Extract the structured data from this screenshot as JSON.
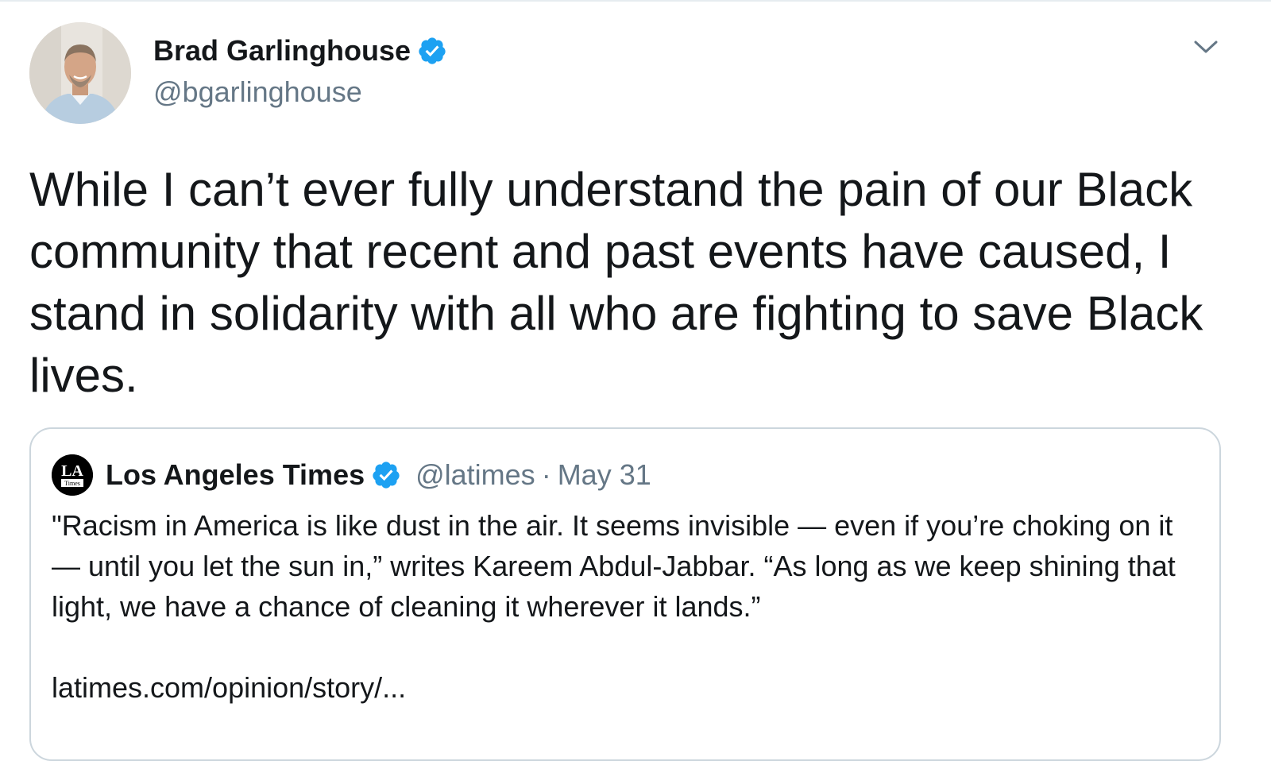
{
  "tweet": {
    "author": {
      "name": "Brad Garlinghouse",
      "handle": "@bgarlinghouse",
      "verified": true
    },
    "text": "While I can’t ever fully understand the pain of our Black community that recent and past events have caused, I stand in solidarity with all who are fighting to save Black lives.",
    "menu_icon": "chevron-down-icon"
  },
  "quoted": {
    "author": {
      "name": "Los Angeles Times",
      "handle": "@latimes",
      "verified": true,
      "avatar_text": "LA Times"
    },
    "separator": "·",
    "date": "May 31",
    "text": "\"Racism in America is like dust in the air. It seems invisible — even if you’re choking on it — until you let the sun in,” writes Kareem Abdul-Jabbar. “As long as we keep shining that light, we have a chance of cleaning it wherever it lands.”",
    "link": "latimes.com/opinion/story/..."
  },
  "colors": {
    "verified_blue": "#1da1f2",
    "secondary_text": "#657786",
    "primary_text": "#14171a",
    "border": "#ccd6dd"
  }
}
